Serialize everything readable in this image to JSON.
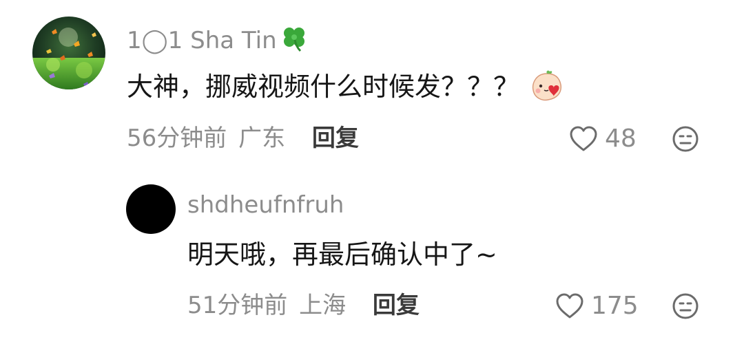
{
  "comments": [
    {
      "username": "1◯1 Sha Tin",
      "username_emoji_icon": "four-leaf-clover-icon",
      "text": "大神，挪威视频什么时候发？？？",
      "sticker_icon": "blushing-peach-sticker",
      "time": "56分钟前",
      "location": "广东",
      "reply_label": "回复",
      "likes": "48"
    },
    {
      "username": "shdheufnfruh",
      "text": "明天哦，再最后确认中了~",
      "time": "51分钟前",
      "location": "上海",
      "reply_label": "回复",
      "likes": "175"
    }
  ],
  "colors": {
    "username": "#8c8c8c",
    "text": "#161616",
    "meta": "#8c8c8c",
    "reply": "#3a3a3a",
    "icon_gray": "#6b6b6b"
  }
}
